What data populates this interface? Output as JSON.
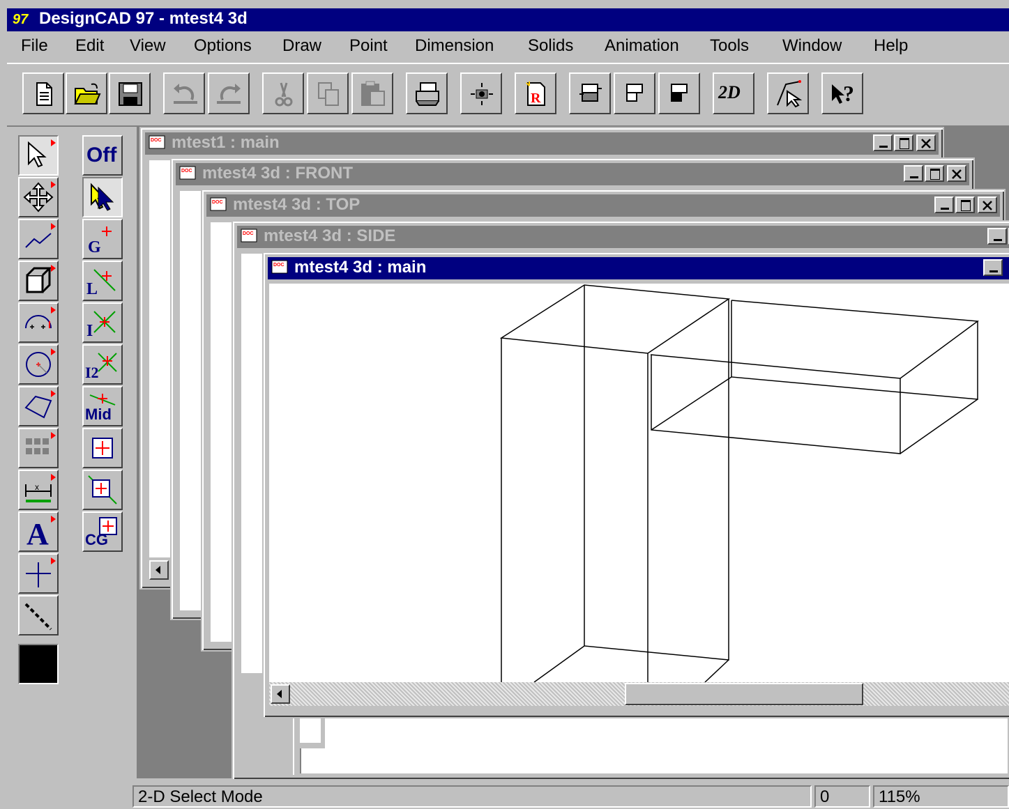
{
  "app": {
    "title": "DesignCAD 97 - mtest4 3d",
    "icon_text": "97"
  },
  "menu": [
    "File",
    "Edit",
    "View",
    "Options",
    "Draw",
    "Point",
    "Dimension",
    "Solids",
    "Animation",
    "Tools",
    "Window",
    "Help"
  ],
  "toolbar": {
    "buttons": [
      "new-document-icon",
      "open-folder-icon",
      "save-disk-icon",
      "undo-icon",
      "redo-icon",
      "cut-icon",
      "copy-icon",
      "paste-icon",
      "print-icon",
      "view-center-icon",
      "render-icon",
      "view-1-icon",
      "view-2-icon",
      "view-3-icon",
      "2d-mode-icon",
      "point-select-icon",
      "help-pointer-icon"
    ],
    "label_2d": "2D"
  },
  "tools_palette": [
    "select-arrow-icon",
    "move-icon",
    "line-icon",
    "solid-cube-icon",
    "arc-icon",
    "circle-icon",
    "polygon-icon",
    "grid-icon",
    "dimension-icon",
    "text-icon",
    "axis-icon",
    "dashed-line-icon",
    "color-swatch"
  ],
  "snap_palette": {
    "off_label": "Off",
    "items": [
      {
        "name": "gravity-snap",
        "label": "G"
      },
      {
        "name": "line-snap",
        "label": "L"
      },
      {
        "name": "intersection-snap",
        "label": "I"
      },
      {
        "name": "intersection2-snap",
        "label": "I2"
      },
      {
        "name": "midpoint-snap",
        "label": "Mid"
      },
      {
        "name": "center-snap",
        "label": ""
      },
      {
        "name": "perpendicular-snap",
        "label": ""
      },
      {
        "name": "cg-snap",
        "label": "CG"
      }
    ]
  },
  "colors": {
    "active_title": "#000080",
    "inactive_title": "#808080",
    "face": "#c0c0c0",
    "mdi_bg": "#808080",
    "current_color": "#000000"
  },
  "windows": [
    {
      "title": "mtest1 : main",
      "active": false
    },
    {
      "title": "mtest4 3d : FRONT",
      "active": false
    },
    {
      "title": "mtest4 3d : TOP",
      "active": false
    },
    {
      "title": "mtest4 3d : SIDE",
      "active": false
    },
    {
      "title": "mtest4 3d : main",
      "active": true
    }
  ],
  "status": {
    "mode": "2-D Select Mode",
    "count": "0",
    "zoom": "115%"
  }
}
